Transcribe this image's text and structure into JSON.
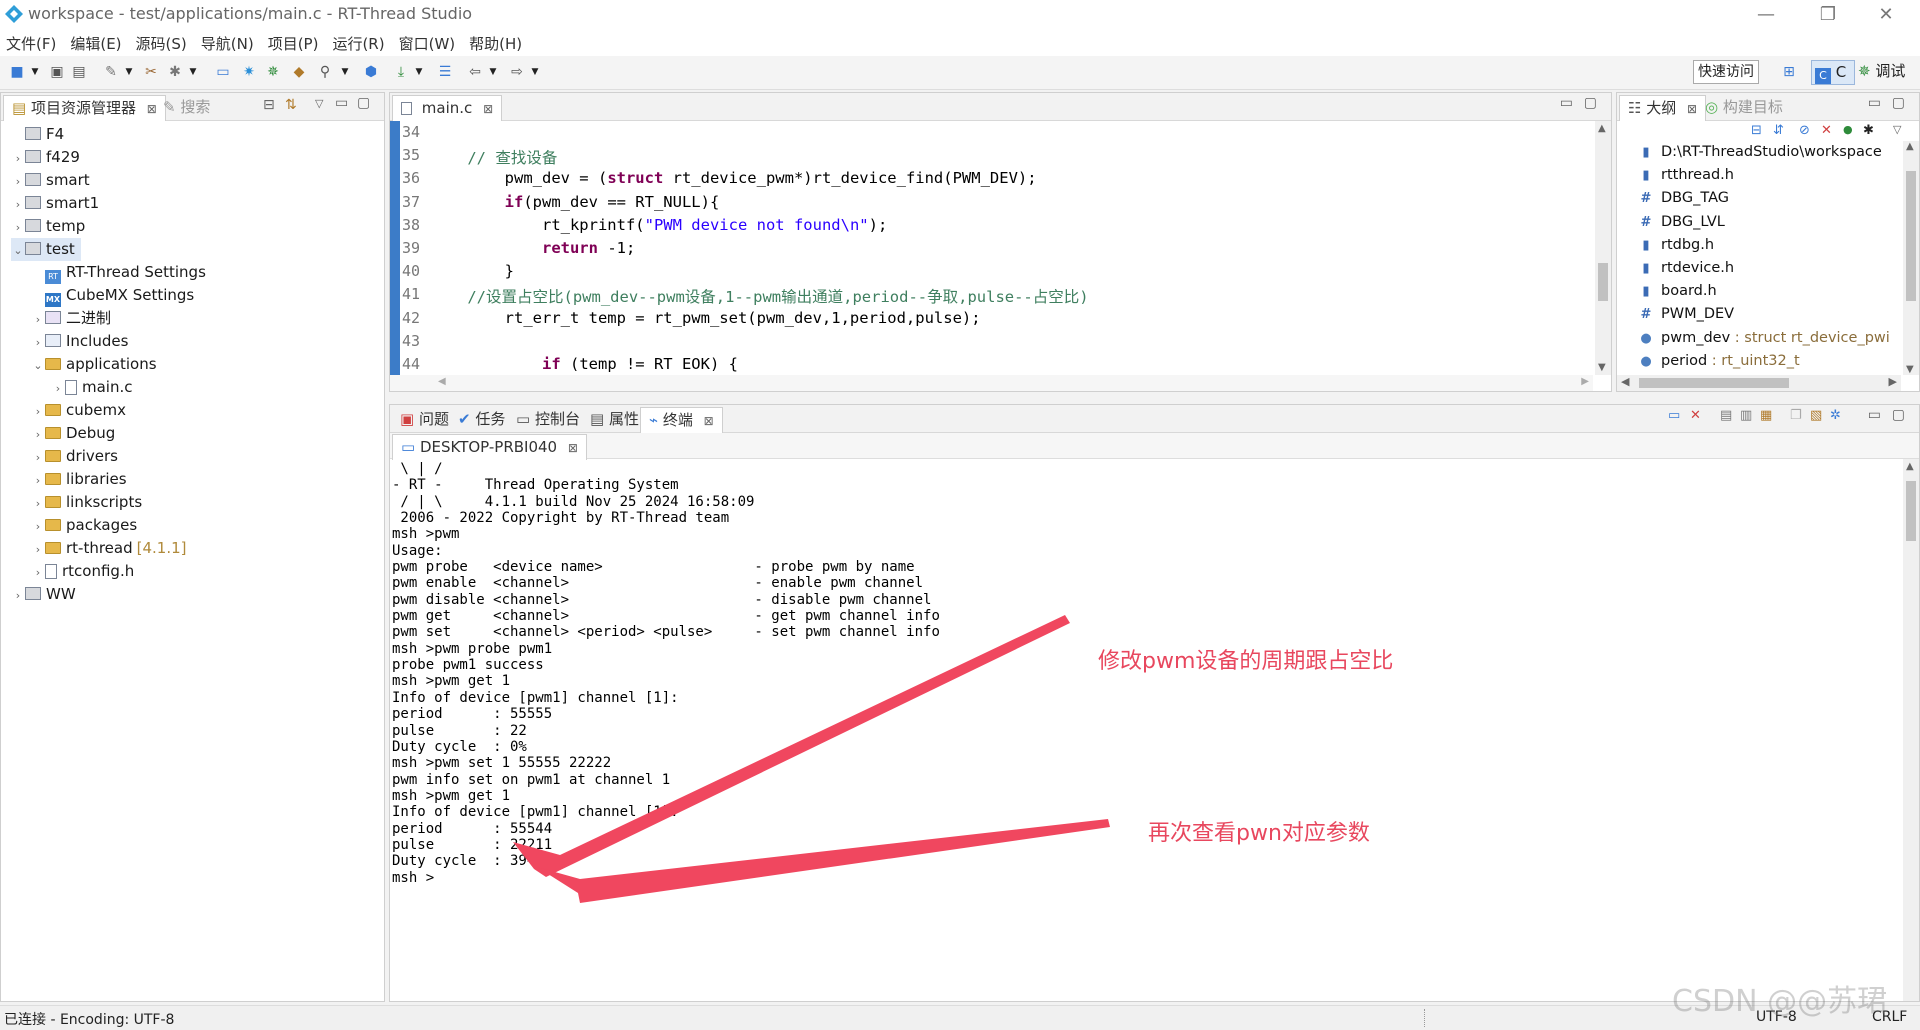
{
  "window": {
    "title": "workspace - test/applications/main.c - RT-Thread Studio",
    "minimize": "—",
    "maximize": "❐",
    "close": "✕"
  },
  "menu": [
    "文件(F)",
    "编辑(E)",
    "源码(S)",
    "导航(N)",
    "项目(P)",
    "运行(R)",
    "窗口(W)",
    "帮助(H)"
  ],
  "toolbar": {
    "quick_access": "快速访问",
    "perspective_c": "C",
    "perspective_debug": "调试"
  },
  "project_explorer": {
    "tabs": [
      {
        "label": "项目资源管理器",
        "active": true
      },
      {
        "label": "搜索",
        "active": false
      }
    ],
    "items": [
      {
        "label": "F4",
        "type": "project",
        "level": 0,
        "expand": ""
      },
      {
        "label": "f429",
        "type": "project",
        "level": 0,
        "expand": "›"
      },
      {
        "label": "smart",
        "type": "project",
        "level": 0,
        "expand": "›"
      },
      {
        "label": "smart1",
        "type": "project",
        "level": 0,
        "expand": "›"
      },
      {
        "label": "temp",
        "type": "project",
        "level": 0,
        "expand": "›"
      },
      {
        "label": "test",
        "type": "project",
        "level": 0,
        "expand": "⌄",
        "selected": true
      },
      {
        "label": "RT-Thread Settings",
        "type": "rt",
        "level": 1,
        "expand": ""
      },
      {
        "label": "CubeMX Settings",
        "type": "mx",
        "level": 1,
        "expand": ""
      },
      {
        "label": "二进制",
        "type": "binary",
        "level": 1,
        "expand": "›"
      },
      {
        "label": "Includes",
        "type": "includes",
        "level": 1,
        "expand": "›"
      },
      {
        "label": "applications",
        "type": "folder",
        "level": 1,
        "expand": "⌄"
      },
      {
        "label": "main.c",
        "type": "file",
        "level": 2,
        "expand": "›"
      },
      {
        "label": "cubemx",
        "type": "folder",
        "level": 1,
        "expand": "›"
      },
      {
        "label": "Debug",
        "type": "folder",
        "level": 1,
        "expand": "›"
      },
      {
        "label": "drivers",
        "type": "folder",
        "level": 1,
        "expand": "›"
      },
      {
        "label": "libraries",
        "type": "folder",
        "level": 1,
        "expand": "›"
      },
      {
        "label": "linkscripts",
        "type": "folder",
        "level": 1,
        "expand": "›"
      },
      {
        "label": "packages",
        "type": "folder",
        "level": 1,
        "expand": "›"
      },
      {
        "label": "rt-thread",
        "type": "folder",
        "level": 1,
        "expand": "›",
        "suffix": "[4.1.1]"
      },
      {
        "label": "rtconfig.h",
        "type": "file",
        "level": 1,
        "expand": "›"
      },
      {
        "label": "WW",
        "type": "project",
        "level": 0,
        "expand": "›"
      }
    ]
  },
  "editor": {
    "tab": "main.c",
    "line_numbers": [
      "34",
      "35",
      "36",
      "37",
      "38",
      "39",
      "40",
      "41",
      "42",
      "43",
      "44"
    ],
    "lines": [
      "",
      "    // 查找设备",
      "        pwm_dev = (struct rt_device_pwm*)rt_device_find(PWM_DEV);",
      "        if(pwm_dev == RT_NULL){",
      "            rt_kprintf(\"PWM device not found\\n\");",
      "            return -1;",
      "        }",
      "    //设置占空比(pwm_dev--pwm设备,1--pwm输出通道,period--争取,pulse--占空比)",
      "        rt_err_t temp = rt_pwm_set(pwm_dev,1,period,pulse);",
      "",
      "            if (temp != RT EOK) {"
    ]
  },
  "outline": {
    "tabs": [
      {
        "label": "大纲",
        "active": true
      },
      {
        "label": "构建目标",
        "active": false
      }
    ],
    "items": [
      {
        "icon": "include-icon",
        "glyph": "▮",
        "color": "#3b6bb5",
        "label": "D:\\RT-ThreadStudio\\workspace",
        "type": ""
      },
      {
        "icon": "include-icon",
        "glyph": "▮",
        "color": "#3b6bb5",
        "label": "rtthread.h",
        "type": ""
      },
      {
        "icon": "macro-icon",
        "glyph": "#",
        "color": "#3b6bb5",
        "label": "DBG_TAG",
        "type": ""
      },
      {
        "icon": "macro-icon",
        "glyph": "#",
        "color": "#3b6bb5",
        "label": "DBG_LVL",
        "type": ""
      },
      {
        "icon": "include-icon",
        "glyph": "▮",
        "color": "#3b6bb5",
        "label": "rtdbg.h",
        "type": ""
      },
      {
        "icon": "include-icon",
        "glyph": "▮",
        "color": "#3b6bb5",
        "label": "rtdevice.h",
        "type": ""
      },
      {
        "icon": "include-icon",
        "glyph": "▮",
        "color": "#3b6bb5",
        "label": "board.h",
        "type": ""
      },
      {
        "icon": "macro-icon",
        "glyph": "#",
        "color": "#3b6bb5",
        "label": "PWM_DEV",
        "type": ""
      },
      {
        "icon": "static-var-icon",
        "glyph": "●",
        "color": "#4d7fc0",
        "label": "pwm_dev",
        "type": " : struct rt_device_pwi"
      },
      {
        "icon": "var-icon",
        "glyph": "●",
        "color": "#4d7fc0",
        "label": "period",
        "type": " : rt_uint32_t"
      }
    ]
  },
  "bottom": {
    "tabs": [
      {
        "label": "问题",
        "active": false
      },
      {
        "label": "任务",
        "active": false
      },
      {
        "label": "控制台",
        "active": false
      },
      {
        "label": "属性",
        "active": false
      },
      {
        "label": "终端",
        "active": true
      }
    ],
    "terminal_tab": "DESKTOP-PRBI040",
    "terminal_lines": [
      " \\ | /",
      "- RT -     Thread Operating System",
      " / | \\     4.1.1 build Nov 25 2024 16:58:09",
      " 2006 - 2022 Copyright by RT-Thread team",
      "msh >pwm",
      "Usage:",
      "pwm probe   <device name>                  - probe pwm by name",
      "pwm enable  <channel>                      - enable pwm channel",
      "pwm disable <channel>                      - disable pwm channel",
      "pwm get     <channel>                      - get pwm channel info",
      "pwm set     <channel> <period> <pulse>     - set pwm channel info",
      "msh >pwm probe pwm1",
      "probe pwm1 success",
      "msh >pwm get 1",
      "Info of device [pwm1] channel [1]:",
      "period      : 55555",
      "pulse       : 22",
      "Duty cycle  : 0%",
      "msh >pwm set 1 55555 22222",
      "pwm info set on pwm1 at channel 1",
      "msh >pwm get 1",
      "Info of device [pwm1] channel [1]:",
      "period      : 55544",
      "pulse       : 22211",
      "Duty cycle  : 39%",
      "msh >"
    ],
    "annotations": {
      "note1": "修改pwm设备的周期跟占空比",
      "note2": "再次查看pwn对应参数",
      "color": "#e8475e"
    }
  },
  "status": {
    "left": "已连接 - Encoding: UTF-8",
    "encoding": "UTF-8",
    "line_ending": "CRLF"
  },
  "watermark": "CSDN @@苏珺"
}
